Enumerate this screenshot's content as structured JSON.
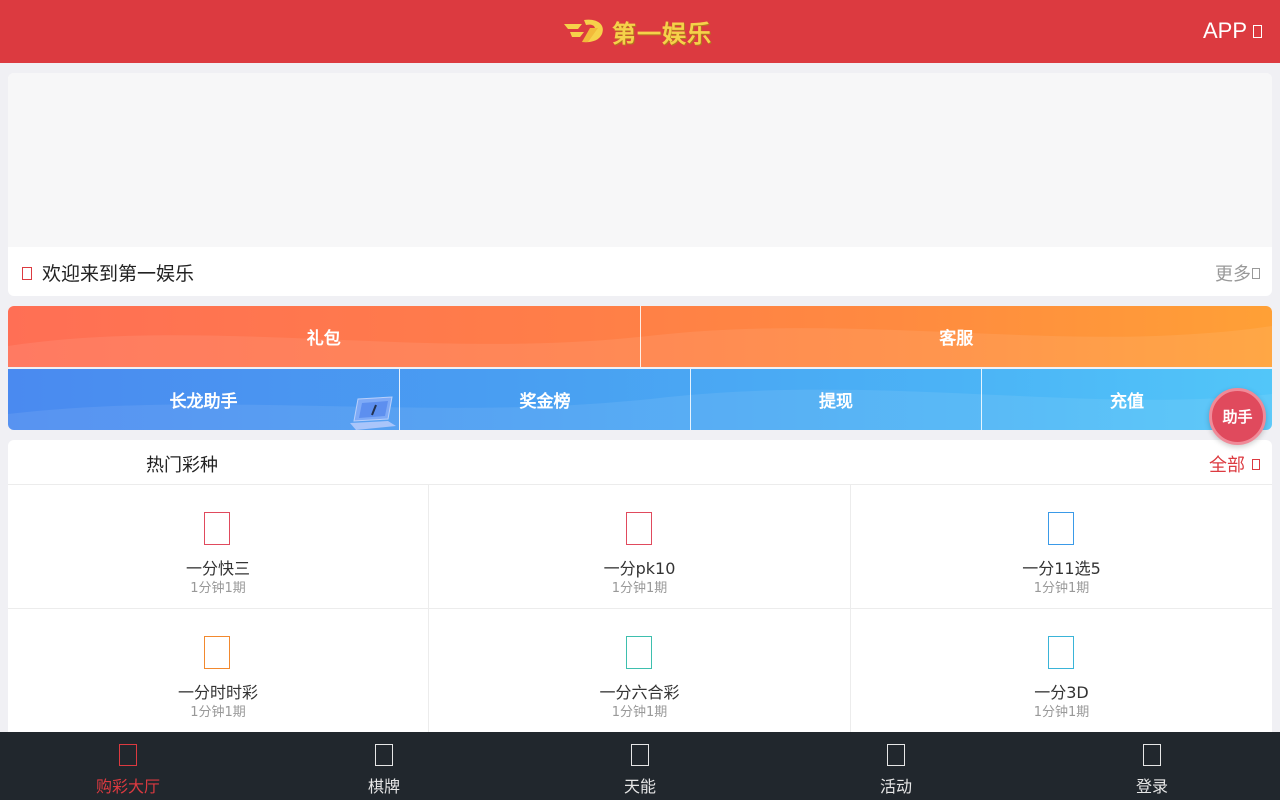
{
  "header": {
    "logo_text": "第一娱乐",
    "logo_icon": "swoosh-logo-icon",
    "app_label": "APP",
    "app_icon": "download-icon",
    "background": "#dc3a40"
  },
  "notice": {
    "icon": "notice-icon",
    "text": "欢迎来到第一娱乐",
    "more_label": "更多",
    "more_icon": "chevron-right-icon"
  },
  "quick_actions": {
    "row1": [
      {
        "label": "礼包",
        "icon": "gift"
      },
      {
        "label": "客服",
        "icon": "support"
      }
    ],
    "row2": [
      {
        "label": "长龙助手"
      },
      {
        "label": "奖金榜"
      },
      {
        "label": "提现"
      },
      {
        "label": "充值"
      }
    ]
  },
  "helper": {
    "label": "助手"
  },
  "hot": {
    "title": "热门彩种",
    "all_label": "全部",
    "all_icon": "chevron-right-icon",
    "items": [
      {
        "name": "一分快三",
        "sub": "1分钟1期",
        "color": "#e04a5d"
      },
      {
        "name": "一分pk10",
        "sub": "1分钟1期",
        "color": "#e04a5d"
      },
      {
        "name": "一分11选5",
        "sub": "1分钟1期",
        "color": "#3a9ae8"
      },
      {
        "name": "一分时时彩",
        "sub": "1分钟1期",
        "color": "#f2892e"
      },
      {
        "name": "一分六合彩",
        "sub": "1分钟1期",
        "color": "#3ebfae"
      },
      {
        "name": "一分3D",
        "sub": "1分钟1期",
        "color": "#3ab4d8"
      }
    ]
  },
  "tabbar": {
    "items": [
      {
        "label": "购彩大厅",
        "icon": "lottery-hall-icon",
        "active": true
      },
      {
        "label": "棋牌",
        "icon": "cards-icon",
        "active": false
      },
      {
        "label": "天能",
        "icon": "power-icon",
        "active": false
      },
      {
        "label": "活动",
        "icon": "events-icon",
        "active": false
      },
      {
        "label": "登录",
        "icon": "login-icon",
        "active": false
      }
    ],
    "active_color": "#dc3a40"
  }
}
